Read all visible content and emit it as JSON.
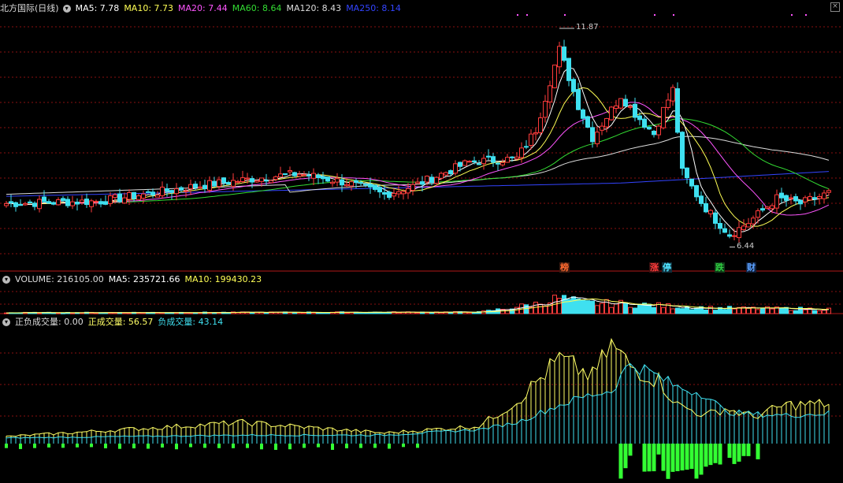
{
  "main_header": {
    "title": "北方国际(日线)",
    "ma5": "MA5: 7.78",
    "ma10": "MA10: 7.73",
    "ma20": "MA20: 7.44",
    "ma60": "MA60: 8.64",
    "ma120": "MA120: 8.43",
    "ma250": "MA250: 8.14"
  },
  "volume_header": {
    "volume": "VOLUME: 216105.00",
    "ma5": "MA5: 235721.66",
    "ma10": "MA10: 199430.23"
  },
  "indicator_header": {
    "name": "正负成交量",
    "value": ": 0.00",
    "positive": "正成交量: 56.57",
    "negative": "负成交量: 43.14"
  },
  "annotations": {
    "high": "11.87",
    "low": "6.44"
  },
  "flags": [
    {
      "text": "榜",
      "color": "#ff6a2f"
    },
    {
      "text": "涨",
      "color": "#ff3b3b"
    },
    {
      "text": "停",
      "color": "#4fe3ff"
    },
    {
      "text": "跌",
      "color": "#2ecc40"
    },
    {
      "text": "财",
      "color": "#5aa0ff"
    }
  ],
  "colors": {
    "up": "#ff3b3b",
    "down": "#3fe0f0",
    "ma5": "#ffffff",
    "ma10": "#ffff55",
    "ma20": "#ff55ff",
    "ma60": "#33dd33",
    "ma120": "#dddddd",
    "ma250": "#3344ff",
    "grid": "#8a1010",
    "pos_line": "#ffff66",
    "neg_line": "#3fe0f0",
    "neg_bar": "#33ff33"
  },
  "chart_data": {
    "type": "candlestick",
    "panels": [
      "price",
      "volume",
      "indicator"
    ],
    "price_ylim": [
      6.0,
      12.3
    ],
    "annotations": [
      {
        "label": "11.87",
        "value": 11.87
      },
      {
        "label": "6.44",
        "value": 6.44
      }
    ],
    "volume_ylim": [
      0,
      950000
    ],
    "indicator_ylim": [
      -60,
      160
    ],
    "keypoints": [
      {
        "i": 0,
        "c": 7.52
      },
      {
        "i": 20,
        "c": 7.58
      },
      {
        "i": 40,
        "c": 7.95
      },
      {
        "i": 55,
        "c": 8.18
      },
      {
        "i": 62,
        "c": 8.26
      },
      {
        "i": 72,
        "c": 8.04
      },
      {
        "i": 80,
        "c": 7.74
      },
      {
        "i": 86,
        "c": 7.95
      },
      {
        "i": 98,
        "c": 8.55
      },
      {
        "i": 108,
        "c": 8.64
      },
      {
        "i": 112,
        "c": 9.35
      },
      {
        "i": 117,
        "c": 11.35
      },
      {
        "i": 121,
        "c": 9.95
      },
      {
        "i": 124,
        "c": 9.15
      },
      {
        "i": 130,
        "c": 10.2
      },
      {
        "i": 133,
        "c": 9.75
      },
      {
        "i": 137,
        "c": 9.25
      },
      {
        "i": 139,
        "c": 9.85
      },
      {
        "i": 141,
        "c": 10.35
      },
      {
        "i": 143,
        "c": 8.3
      },
      {
        "i": 147,
        "c": 7.55
      },
      {
        "i": 150,
        "c": 7.12
      },
      {
        "i": 153,
        "c": 6.75
      },
      {
        "i": 157,
        "c": 7.05
      },
      {
        "i": 163,
        "c": 7.65
      },
      {
        "i": 168,
        "c": 7.52
      },
      {
        "i": 174,
        "c": 7.78
      }
    ],
    "volume_keypoints": [
      {
        "i": 0,
        "v": 30000
      },
      {
        "i": 100,
        "v": 50000
      },
      {
        "i": 105,
        "v": 150000
      },
      {
        "i": 112,
        "v": 320000
      },
      {
        "i": 117,
        "v": 520000
      },
      {
        "i": 122,
        "v": 350000
      },
      {
        "i": 130,
        "v": 330000
      },
      {
        "i": 140,
        "v": 250000
      },
      {
        "i": 150,
        "v": 180000
      },
      {
        "i": 174,
        "v": 150000
      }
    ],
    "indicator_keypoints": [
      {
        "i": 0,
        "p": 10,
        "n": 8
      },
      {
        "i": 50,
        "p": 30,
        "n": 12
      },
      {
        "i": 80,
        "p": 15,
        "n": 12
      },
      {
        "i": 100,
        "p": 25,
        "n": 20
      },
      {
        "i": 108,
        "p": 60,
        "n": 30
      },
      {
        "i": 117,
        "p": 120,
        "n": 55
      },
      {
        "i": 124,
        "p": 95,
        "n": 70
      },
      {
        "i": 128,
        "p": 140,
        "n": 75
      },
      {
        "i": 132,
        "p": 110,
        "n": 115
      },
      {
        "i": 138,
        "p": 90,
        "n": 95
      },
      {
        "i": 142,
        "p": 55,
        "n": 80
      },
      {
        "i": 148,
        "p": 40,
        "n": 70
      },
      {
        "i": 152,
        "p": 50,
        "n": 45
      },
      {
        "i": 158,
        "p": 38,
        "n": 42
      },
      {
        "i": 165,
        "p": 55,
        "n": 40
      },
      {
        "i": 174,
        "p": 56.57,
        "n": 43.14
      }
    ],
    "series": [
      {
        "name": "MA5",
        "last": 7.78
      },
      {
        "name": "MA10",
        "last": 7.73
      },
      {
        "name": "MA20",
        "last": 7.44
      },
      {
        "name": "MA60",
        "last": 8.64
      },
      {
        "name": "MA120",
        "last": 8.43
      },
      {
        "name": "MA250",
        "last": 8.14
      },
      {
        "name": "VOLUME",
        "last": 216105.0
      },
      {
        "name": "正成交量",
        "last": 56.57
      },
      {
        "name": "负成交量",
        "last": 43.14
      }
    ]
  }
}
